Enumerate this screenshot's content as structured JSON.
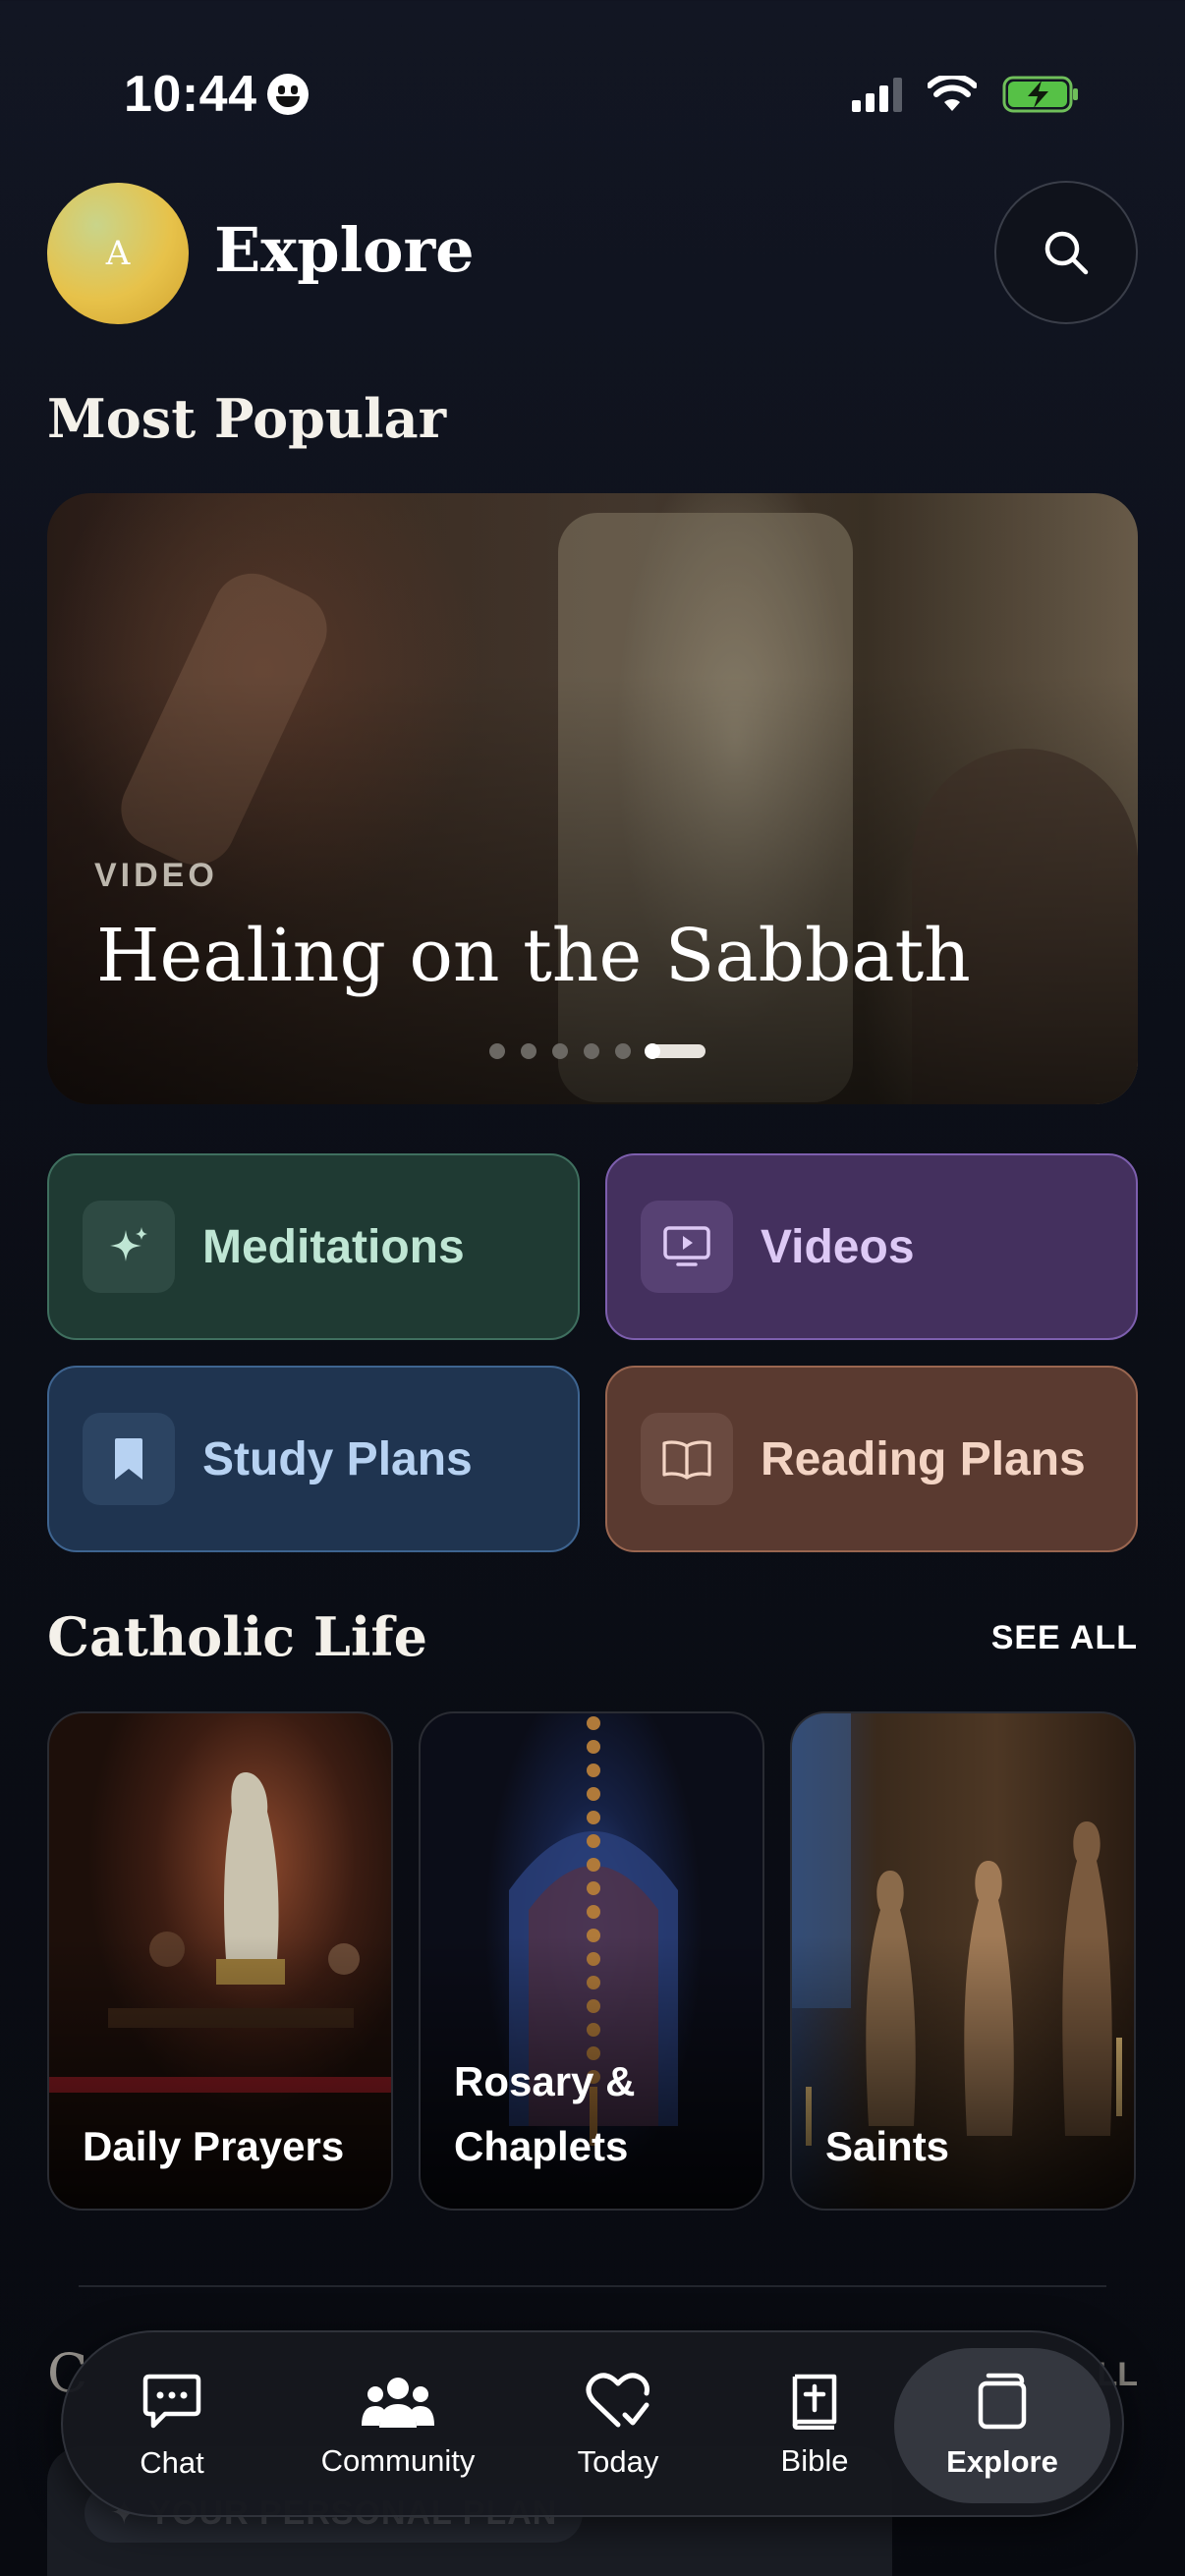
{
  "status_bar": {
    "time": "10:44"
  },
  "header": {
    "avatar_initial": "A",
    "title": "Explore"
  },
  "most_popular": {
    "title": "Most Popular",
    "hero": {
      "kicker": "VIDEO",
      "title": "Healing on the Sabbath",
      "page_count": 6,
      "active_page": 6
    }
  },
  "categories": [
    {
      "label": "Meditations",
      "icon": "sparkle-icon"
    },
    {
      "label": "Videos",
      "icon": "video-screen-icon"
    },
    {
      "label": "Study Plans",
      "icon": "bookmark-icon"
    },
    {
      "label": "Reading Plans",
      "icon": "open-book-icon"
    }
  ],
  "catholic_life": {
    "title": "Catholic Life",
    "see_all": "SEE ALL",
    "cards": [
      {
        "label": "Daily Prayers"
      },
      {
        "label": "Rosary &\nChaplets"
      },
      {
        "label": "Saints"
      }
    ]
  },
  "next_section": {
    "title_fragment": "C",
    "see_all_fragment": "LL",
    "pill": "YOUR PERSONAL PLAN"
  },
  "tabbar": {
    "tabs": [
      {
        "label": "Chat",
        "icon": "chat-bubble-icon"
      },
      {
        "label": "Community",
        "icon": "people-icon"
      },
      {
        "label": "Today",
        "icon": "heart-check-icon"
      },
      {
        "label": "Bible",
        "icon": "bible-icon"
      },
      {
        "label": "Explore",
        "icon": "cards-icon",
        "active": true
      }
    ]
  },
  "colors": {
    "background": "#0c0f18",
    "avatar": "#e7c24a",
    "meditations": "#1f3a33",
    "videos": "#44305e",
    "study_plans": "#1f3450",
    "reading_plans": "#5a3a30"
  }
}
